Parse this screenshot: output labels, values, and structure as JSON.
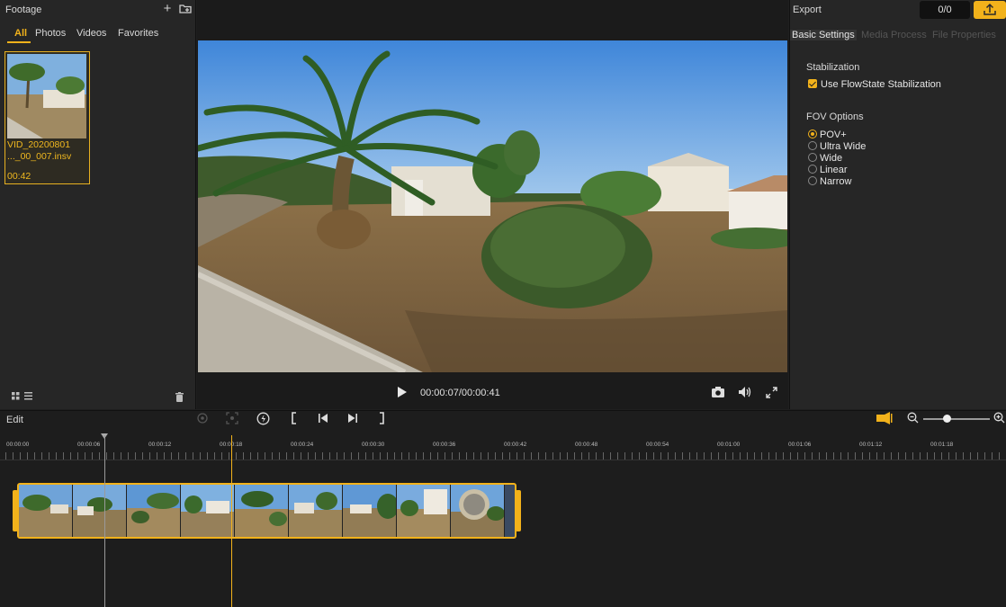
{
  "footage": {
    "title": "Footage",
    "tabs": [
      "All",
      "Photos",
      "Videos",
      "Favorites"
    ],
    "active_tab": "All",
    "item": {
      "filename_line1": "VID_20200801",
      "filename_line2": "..._00_007.insv",
      "duration": "00:42"
    }
  },
  "preview": {
    "time": "00:00:07/00:00:41"
  },
  "export": {
    "title": "Export",
    "count": "0/0",
    "tabs": [
      "Basic Settings",
      "Media Process",
      "File Properties"
    ],
    "active_tab": "Basic Settings",
    "stabilization": {
      "title": "Stabilization",
      "checkbox_label": "Use FlowState Stabilization",
      "checked": true
    },
    "fov": {
      "title": "FOV Options",
      "options": [
        "POV+",
        "Ultra Wide",
        "Wide",
        "Linear",
        "Narrow"
      ],
      "selected": "POV+"
    }
  },
  "edit": {
    "title": "Edit",
    "ruler_labels": [
      "00:00:00",
      "00:00:06",
      "00:00:12",
      "00:00:18",
      "00:00:24",
      "00:00:30",
      "00:00:36",
      "00:00:42",
      "00:00:48",
      "00:00:54",
      "00:01:00",
      "00:01:06",
      "00:01:12",
      "00:01:18"
    ]
  },
  "colors": {
    "accent": "#f2b21b",
    "panel": "#262626",
    "background": "#1d1d1d"
  },
  "icons": [
    "plus-icon",
    "import-folder-icon",
    "grid-view-icon",
    "list-view-icon",
    "trash-icon",
    "play-icon",
    "camera-icon",
    "volume-icon",
    "fullscreen-icon",
    "share-icon",
    "keyframe-icon",
    "reframe-icon",
    "speed-icon",
    "trim-start-icon",
    "prev-frame-icon",
    "next-frame-icon",
    "trim-end-icon",
    "audio-track-icon",
    "zoom-out-icon",
    "zoom-in-icon"
  ]
}
